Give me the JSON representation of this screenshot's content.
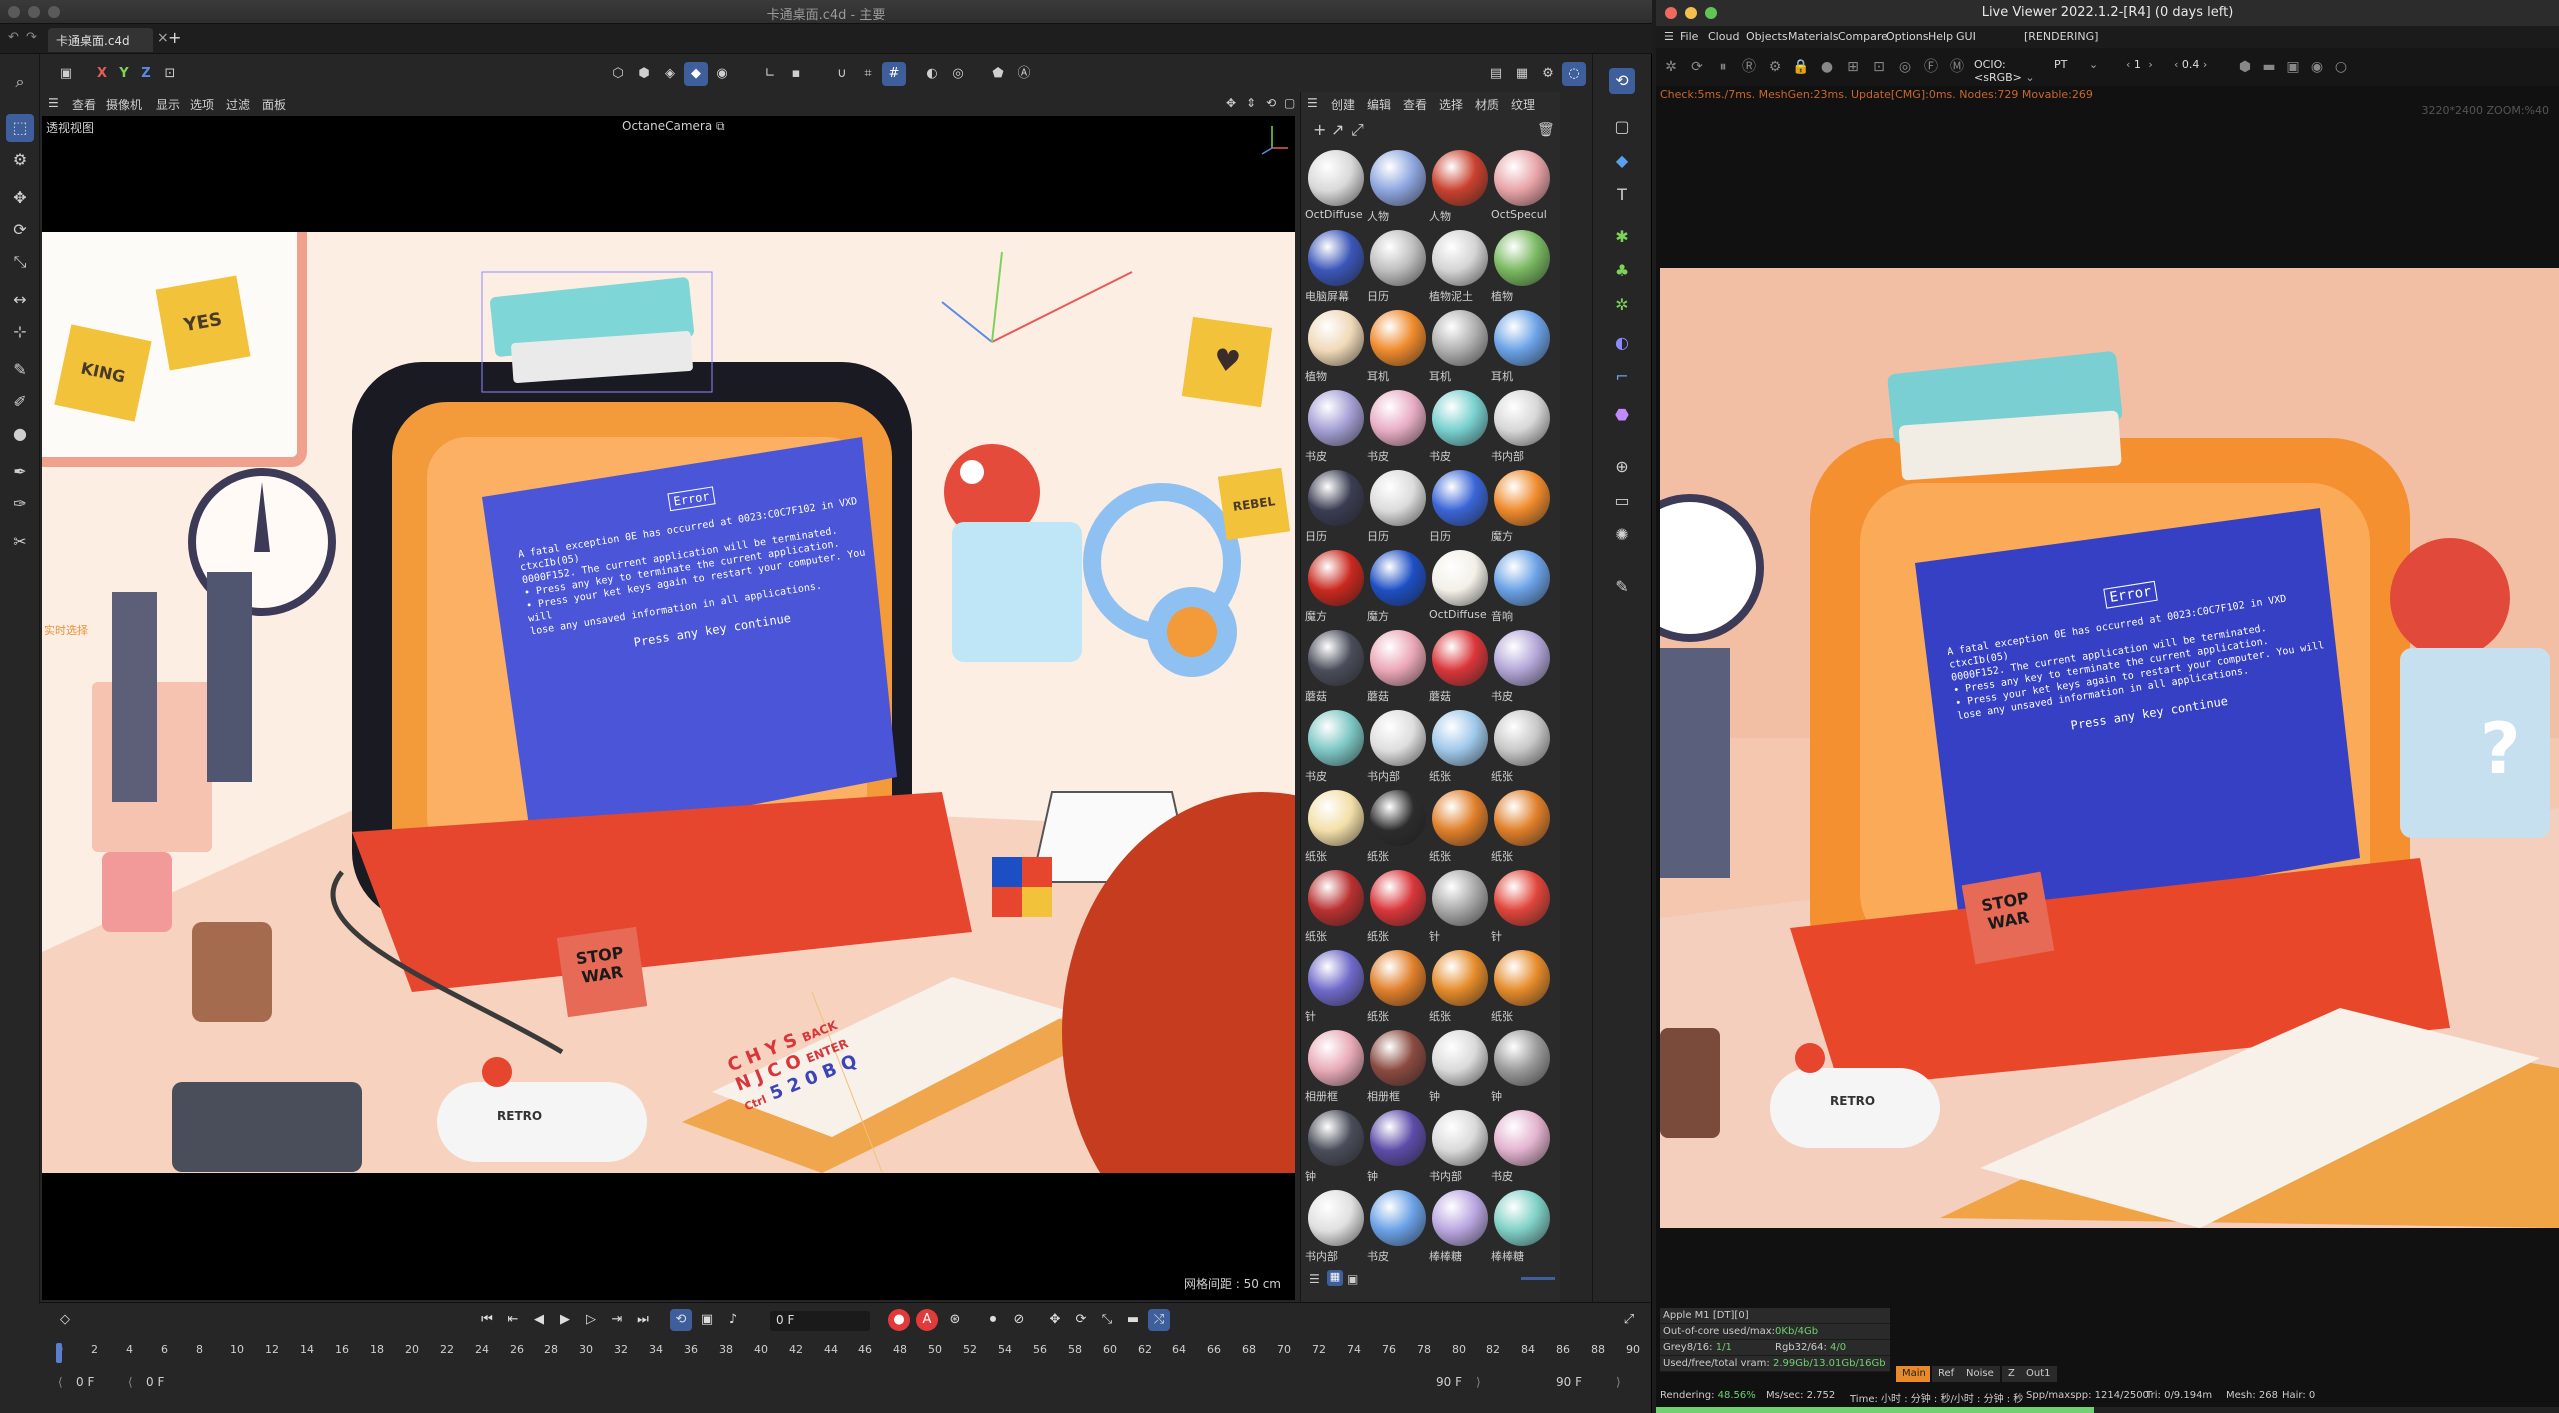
{
  "c4d": {
    "window_title": "卡通桌面.c4d - 主要",
    "doc_tab": "卡通桌面.c4d",
    "viewport": {
      "menu": [
        "查看",
        "摄像机",
        "显示",
        "选项",
        "过滤",
        "面板"
      ],
      "label": "透视视图",
      "camera": "OctaneCamera",
      "camera_icon": "camera-link-icon",
      "grid_spacing": "网格间距 : 50 cm",
      "overlay_text": "实时选择"
    },
    "material_panel": {
      "menu": [
        "创建",
        "编辑",
        "查看",
        "选择",
        "材质",
        "纹理"
      ],
      "materials": [
        {
          "label": "OctDiffuse",
          "color": "#d9d9d9"
        },
        {
          "label": "人物",
          "color": "#8ea6df"
        },
        {
          "label": "人物",
          "color": "#c9412e"
        },
        {
          "label": "OctSpecul",
          "color": "#e8a3a7"
        },
        {
          "label": "电脑屏幕",
          "color": "#3b56b8"
        },
        {
          "label": "日历",
          "color": "#bfbfbf"
        },
        {
          "label": "植物泥土",
          "color": "#d4d4d4"
        },
        {
          "label": "植物",
          "color": "#78b860"
        },
        {
          "label": "植物",
          "color": "#f0d9b8"
        },
        {
          "label": "耳机",
          "color": "#ef8a2c"
        },
        {
          "label": "耳机",
          "color": "#b0b0b0"
        },
        {
          "label": "耳机",
          "color": "#6aa1e6"
        },
        {
          "label": "书皮",
          "color": "#a49fd4"
        },
        {
          "label": "书皮",
          "color": "#e8adc4"
        },
        {
          "label": "书皮",
          "color": "#78d0cf"
        },
        {
          "label": "书内部",
          "color": "#d7d7d7"
        },
        {
          "label": "日历",
          "color": "#3a3d52"
        },
        {
          "label": "日历",
          "color": "#dcdcdc"
        },
        {
          "label": "日历",
          "color": "#3a65d6"
        },
        {
          "label": "魔方",
          "color": "#ef8a2c"
        },
        {
          "label": "魔方",
          "color": "#c9281e"
        },
        {
          "label": "魔方",
          "color": "#1d4fc4"
        },
        {
          "label": "OctDiffuse",
          "color": "#f3f0e8"
        },
        {
          "label": "音响",
          "color": "#6aa1e6"
        },
        {
          "label": "蘑菇",
          "color": "#4a4d5a"
        },
        {
          "label": "蘑菇",
          "color": "#eba7b7"
        },
        {
          "label": "蘑菇",
          "color": "#d9363a"
        },
        {
          "label": "书皮",
          "color": "#b3a6d8"
        },
        {
          "label": "书皮",
          "color": "#7cc7c4"
        },
        {
          "label": "书内部",
          "color": "#dedede"
        },
        {
          "label": "纸张",
          "color": "#9fc8ea"
        },
        {
          "label": "纸张",
          "color": "#c8c8c8"
        },
        {
          "label": "纸张",
          "color": "#f3dfa8"
        },
        {
          "label": "纸张",
          "color": "#2c2c2c"
        },
        {
          "label": "纸张",
          "color": "#e07f2a"
        },
        {
          "label": "纸张",
          "color": "#e07f2a"
        },
        {
          "label": "纸张",
          "color": "#b93030"
        },
        {
          "label": "纸张",
          "color": "#d9363a"
        },
        {
          "label": "针",
          "color": "#a9a9a9"
        },
        {
          "label": "针",
          "color": "#e0453a"
        },
        {
          "label": "针",
          "color": "#6f69c9"
        },
        {
          "label": "纸张",
          "color": "#e07f2a"
        },
        {
          "label": "纸张",
          "color": "#e58b2a"
        },
        {
          "label": "纸张",
          "color": "#e58b2a"
        },
        {
          "label": "相册框",
          "color": "#e8aab7"
        },
        {
          "label": "相册框",
          "color": "#8a4a40"
        },
        {
          "label": "钟",
          "color": "#dadada"
        },
        {
          "label": "钟",
          "color": "#9a9a9a"
        },
        {
          "label": "钟",
          "color": "#4a4d5a"
        },
        {
          "label": "钟",
          "color": "#5d4ca8"
        },
        {
          "label": "书内部",
          "color": "#dadada"
        },
        {
          "label": "书皮",
          "color": "#e3b3cf"
        },
        {
          "label": "书内部",
          "color": "#e0e0e0"
        },
        {
          "label": "书皮",
          "color": "#6aa1e6"
        },
        {
          "label": "棒棒糖",
          "color": "#b9a6e0"
        },
        {
          "label": "棒棒糖",
          "color": "#7fd0c6"
        }
      ]
    },
    "timeline": {
      "current_frame": "0 F",
      "ticks": [
        "0",
        "2",
        "4",
        "6",
        "8",
        "10",
        "12",
        "14",
        "16",
        "18",
        "20",
        "22",
        "24",
        "26",
        "28",
        "30",
        "32",
        "34",
        "36",
        "38",
        "40",
        "42",
        "44",
        "46",
        "48",
        "50",
        "52",
        "54",
        "56",
        "58",
        "60",
        "62",
        "64",
        "66",
        "68",
        "70",
        "72",
        "74",
        "76",
        "78",
        "80",
        "82",
        "84",
        "86",
        "88",
        "90"
      ],
      "start": "0 F",
      "start2": "0 F",
      "end": "90 F",
      "end2": "90 F"
    }
  },
  "scene_text": {
    "screen_title": "Error",
    "screen_lines": [
      "A fatal exception 0E has occurred at 0023:C0C7F102 in VXD ctxcIb(05)",
      "0000F152. The current application will be terminated.",
      "• Press any key to terminate the current application.",
      "• Press your ket keys again to restart your computer. You will",
      "lose any unsaved information in all applications."
    ],
    "screen_continue": "Press any key continue",
    "sticker_stop_war": "STOP WAR",
    "note_yes": "YES",
    "note_king": "KING",
    "note_rebel": "REBEL",
    "controller_label": "RETRO",
    "keys_row1": [
      "C",
      "H",
      "Y",
      "S",
      "BACK"
    ],
    "keys_row2": [
      "N",
      "J",
      "C",
      "O",
      "ENTER"
    ],
    "keys_row3": [
      "Ctrl",
      "5",
      "2",
      "0",
      "B",
      "Q"
    ]
  },
  "liveviewer": {
    "window_title": "Live Viewer 2022.1.2-[R4] (0 days left)",
    "menu": [
      "File",
      "Cloud",
      "Objects",
      "Materials",
      "Compare",
      "Options",
      "Help",
      "GUI"
    ],
    "state": "[RENDERING]",
    "ocio": "OCIO:<sRGB>",
    "kernel": "PT",
    "value_a": "1",
    "value_b": "0.4",
    "status": "Check:5ms./7ms. MeshGen:23ms. Update[CMG]:0ms. Nodes:729 Movable:269",
    "zoom_label": "3220*2400 ZOOM:%40",
    "stats": {
      "gpu": "Apple M1 [DT][0]",
      "out_of_core": "Out-of-core used/max:",
      "out_of_core_val": "0Kb/4Gb",
      "grey": "Grey8/16: ",
      "grey_val": "1/1",
      "rgb": "Rgb32/64: ",
      "rgb_val": "4/0",
      "vram": "Used/free/total vram: ",
      "vram_val": "2.99Gb/13.01Gb/16Gb"
    },
    "channels": [
      "Main",
      "Ref",
      "Noise",
      "Z",
      "Out1"
    ],
    "bottom": {
      "rendering": "Rendering: ",
      "rendering_val": "48.56%",
      "mssec": "Ms/sec: 2.752",
      "time": "Time: 小时 : 分钟 : 秒/小时 : 分钟 : 秒",
      "spp": "Spp/maxspp: 1214/2500",
      "tri": "Tri: 0/9.194m",
      "mesh": "Mesh: 268",
      "hair": "Hair: 0"
    },
    "progress": 0.4856,
    "accent": "#e88a2a"
  }
}
